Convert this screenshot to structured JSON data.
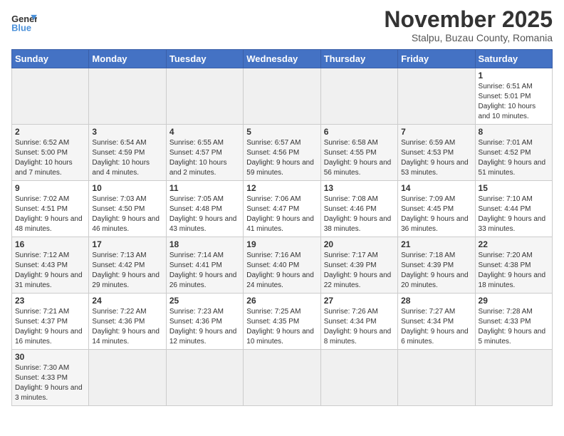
{
  "header": {
    "logo_general": "General",
    "logo_blue": "Blue",
    "month": "November 2025",
    "location": "Stalpu, Buzau County, Romania"
  },
  "weekdays": [
    "Sunday",
    "Monday",
    "Tuesday",
    "Wednesday",
    "Thursday",
    "Friday",
    "Saturday"
  ],
  "days": [
    {
      "date": "",
      "info": ""
    },
    {
      "date": "",
      "info": ""
    },
    {
      "date": "",
      "info": ""
    },
    {
      "date": "",
      "info": ""
    },
    {
      "date": "",
      "info": ""
    },
    {
      "date": "",
      "info": ""
    },
    {
      "date": "1",
      "info": "Sunrise: 6:51 AM\nSunset: 5:01 PM\nDaylight: 10 hours and 10 minutes."
    },
    {
      "date": "2",
      "info": "Sunrise: 6:52 AM\nSunset: 5:00 PM\nDaylight: 10 hours and 7 minutes."
    },
    {
      "date": "3",
      "info": "Sunrise: 6:54 AM\nSunset: 4:59 PM\nDaylight: 10 hours and 4 minutes."
    },
    {
      "date": "4",
      "info": "Sunrise: 6:55 AM\nSunset: 4:57 PM\nDaylight: 10 hours and 2 minutes."
    },
    {
      "date": "5",
      "info": "Sunrise: 6:57 AM\nSunset: 4:56 PM\nDaylight: 9 hours and 59 minutes."
    },
    {
      "date": "6",
      "info": "Sunrise: 6:58 AM\nSunset: 4:55 PM\nDaylight: 9 hours and 56 minutes."
    },
    {
      "date": "7",
      "info": "Sunrise: 6:59 AM\nSunset: 4:53 PM\nDaylight: 9 hours and 53 minutes."
    },
    {
      "date": "8",
      "info": "Sunrise: 7:01 AM\nSunset: 4:52 PM\nDaylight: 9 hours and 51 minutes."
    },
    {
      "date": "9",
      "info": "Sunrise: 7:02 AM\nSunset: 4:51 PM\nDaylight: 9 hours and 48 minutes."
    },
    {
      "date": "10",
      "info": "Sunrise: 7:03 AM\nSunset: 4:50 PM\nDaylight: 9 hours and 46 minutes."
    },
    {
      "date": "11",
      "info": "Sunrise: 7:05 AM\nSunset: 4:48 PM\nDaylight: 9 hours and 43 minutes."
    },
    {
      "date": "12",
      "info": "Sunrise: 7:06 AM\nSunset: 4:47 PM\nDaylight: 9 hours and 41 minutes."
    },
    {
      "date": "13",
      "info": "Sunrise: 7:08 AM\nSunset: 4:46 PM\nDaylight: 9 hours and 38 minutes."
    },
    {
      "date": "14",
      "info": "Sunrise: 7:09 AM\nSunset: 4:45 PM\nDaylight: 9 hours and 36 minutes."
    },
    {
      "date": "15",
      "info": "Sunrise: 7:10 AM\nSunset: 4:44 PM\nDaylight: 9 hours and 33 minutes."
    },
    {
      "date": "16",
      "info": "Sunrise: 7:12 AM\nSunset: 4:43 PM\nDaylight: 9 hours and 31 minutes."
    },
    {
      "date": "17",
      "info": "Sunrise: 7:13 AM\nSunset: 4:42 PM\nDaylight: 9 hours and 29 minutes."
    },
    {
      "date": "18",
      "info": "Sunrise: 7:14 AM\nSunset: 4:41 PM\nDaylight: 9 hours and 26 minutes."
    },
    {
      "date": "19",
      "info": "Sunrise: 7:16 AM\nSunset: 4:40 PM\nDaylight: 9 hours and 24 minutes."
    },
    {
      "date": "20",
      "info": "Sunrise: 7:17 AM\nSunset: 4:39 PM\nDaylight: 9 hours and 22 minutes."
    },
    {
      "date": "21",
      "info": "Sunrise: 7:18 AM\nSunset: 4:39 PM\nDaylight: 9 hours and 20 minutes."
    },
    {
      "date": "22",
      "info": "Sunrise: 7:20 AM\nSunset: 4:38 PM\nDaylight: 9 hours and 18 minutes."
    },
    {
      "date": "23",
      "info": "Sunrise: 7:21 AM\nSunset: 4:37 PM\nDaylight: 9 hours and 16 minutes."
    },
    {
      "date": "24",
      "info": "Sunrise: 7:22 AM\nSunset: 4:36 PM\nDaylight: 9 hours and 14 minutes."
    },
    {
      "date": "25",
      "info": "Sunrise: 7:23 AM\nSunset: 4:36 PM\nDaylight: 9 hours and 12 minutes."
    },
    {
      "date": "26",
      "info": "Sunrise: 7:25 AM\nSunset: 4:35 PM\nDaylight: 9 hours and 10 minutes."
    },
    {
      "date": "27",
      "info": "Sunrise: 7:26 AM\nSunset: 4:34 PM\nDaylight: 9 hours and 8 minutes."
    },
    {
      "date": "28",
      "info": "Sunrise: 7:27 AM\nSunset: 4:34 PM\nDaylight: 9 hours and 6 minutes."
    },
    {
      "date": "29",
      "info": "Sunrise: 7:28 AM\nSunset: 4:33 PM\nDaylight: 9 hours and 5 minutes."
    },
    {
      "date": "30",
      "info": "Sunrise: 7:30 AM\nSunset: 4:33 PM\nDaylight: 9 hours and 3 minutes."
    }
  ]
}
